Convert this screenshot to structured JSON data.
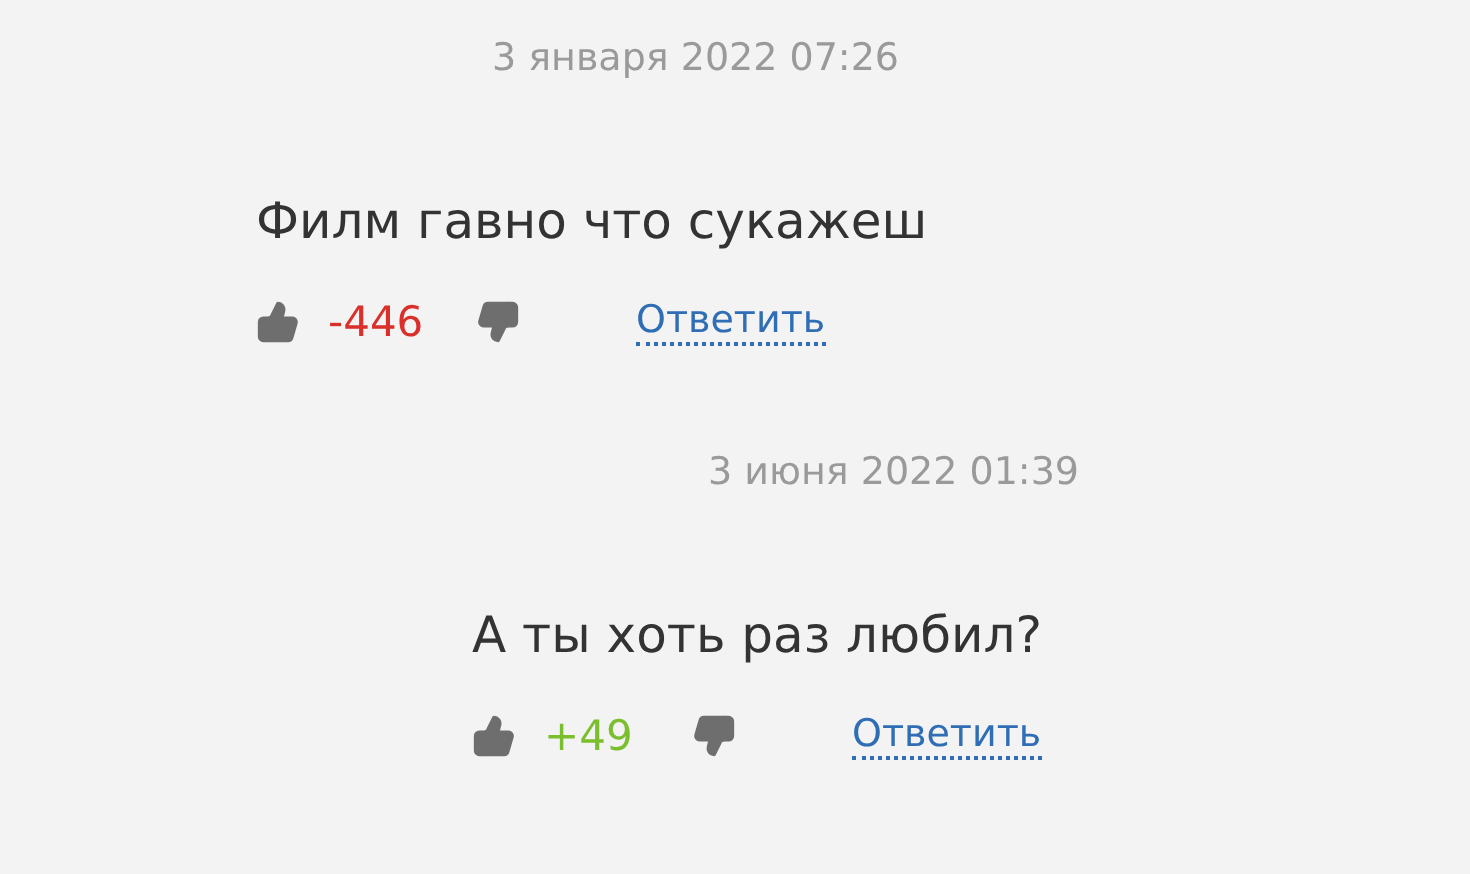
{
  "comments": [
    {
      "date": "3 января 2022 07:26",
      "text": "Филм гавно что сукажеш",
      "score": "-446",
      "color": "#d9302c",
      "reply": "Ответить",
      "children": [
        {
          "date": "3 июня 2022 01:39",
          "text": "А ты хоть раз любил?",
          "score": "+49",
          "color": "#7bbf2e",
          "reply": "Ответить"
        }
      ]
    }
  ]
}
